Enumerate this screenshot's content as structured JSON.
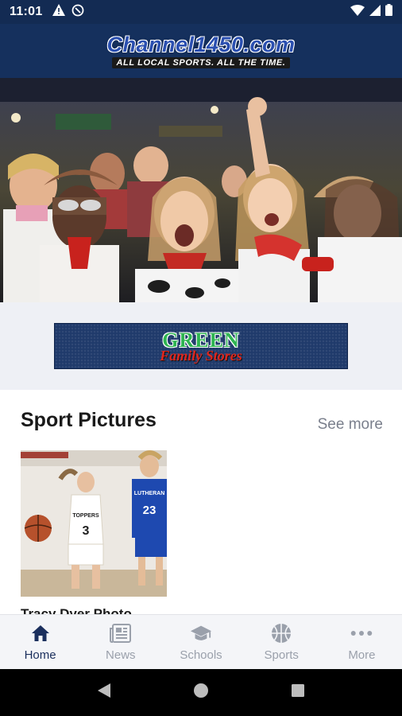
{
  "status_bar": {
    "time": "11:01"
  },
  "header": {
    "logo_main": "Channel1450.com",
    "logo_tagline": "ALL LOCAL SPORTS. ALL THE TIME."
  },
  "ad": {
    "line1": "GREEN",
    "line2": "Family Stores"
  },
  "section": {
    "title": "Sport Pictures",
    "see_more": "See more",
    "cards": [
      {
        "title": "Tracy Dyer Photo",
        "jersey_a": "3",
        "jersey_b": "23",
        "team_a": "TOPPERS",
        "team_b": "LUTHERAN"
      }
    ]
  },
  "bottom_nav": {
    "items": [
      {
        "label": "Home",
        "icon": "home-icon",
        "active": true
      },
      {
        "label": "News",
        "icon": "newspaper-icon",
        "active": false
      },
      {
        "label": "Schools",
        "icon": "graduation-cap-icon",
        "active": false
      },
      {
        "label": "Sports",
        "icon": "basketball-icon",
        "active": false
      },
      {
        "label": "More",
        "icon": "more-dots-icon",
        "active": false
      }
    ]
  },
  "colors": {
    "header_bg": "#15305d",
    "nav_active": "#1b2f5d",
    "nav_inactive": "#9aa0ab"
  }
}
